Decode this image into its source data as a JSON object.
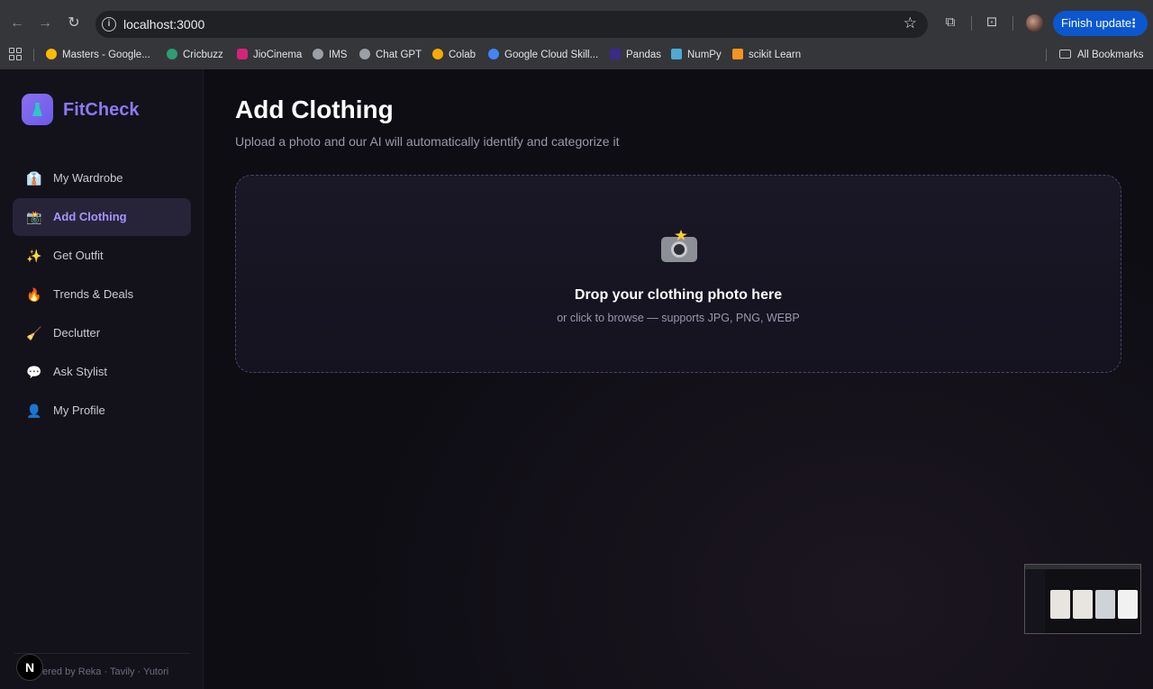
{
  "browser": {
    "url": "localhost:3000",
    "finish_update_label": "Finish update",
    "bookmarks": [
      {
        "label": "Masters - Google...",
        "color": "#fbbc04"
      },
      {
        "label": "Cricbuzz",
        "color": "#2e9d74"
      },
      {
        "label": "JioCinema",
        "color": "#d4247a"
      },
      {
        "label": "IMS",
        "color": "#9aa0a6"
      },
      {
        "label": "Chat GPT",
        "color": "#9aa0a6"
      },
      {
        "label": "Colab",
        "color": "#f9ab00"
      },
      {
        "label": "Google Cloud Skill...",
        "color": "#4285f4"
      },
      {
        "label": "Pandas",
        "color": "#150458"
      },
      {
        "label": "NumPy",
        "color": "#4dabcf"
      },
      {
        "label": "scikit Learn",
        "color": "#f7931e"
      }
    ],
    "all_bookmarks_label": "All Bookmarks"
  },
  "app": {
    "brand": "FitCheck",
    "nav": [
      {
        "label": "My Wardrobe",
        "icon": "👔",
        "active": false
      },
      {
        "label": "Add Clothing",
        "icon": "📸",
        "active": true
      },
      {
        "label": "Get Outfit",
        "icon": "✨",
        "active": false
      },
      {
        "label": "Trends & Deals",
        "icon": "🔥",
        "active": false
      },
      {
        "label": "Declutter",
        "icon": "🧹",
        "active": false
      },
      {
        "label": "Ask Stylist",
        "icon": "💬",
        "active": false
      },
      {
        "label": "My Profile",
        "icon": "👤",
        "active": false
      }
    ],
    "powered_by": "ered by Reka · Tavily · Yutori",
    "dev_badge": "N"
  },
  "page": {
    "title": "Add Clothing",
    "subtitle": "Upload a photo and our AI will automatically identify and categorize it",
    "dropzone": {
      "title": "Drop your clothing photo here",
      "subtitle": "or click to browse — supports JPG, PNG, WEBP"
    }
  },
  "colors": {
    "accent": "#8c78f6",
    "active_nav_bg": "#27243a",
    "finish_update_bg": "#0b57d0"
  }
}
